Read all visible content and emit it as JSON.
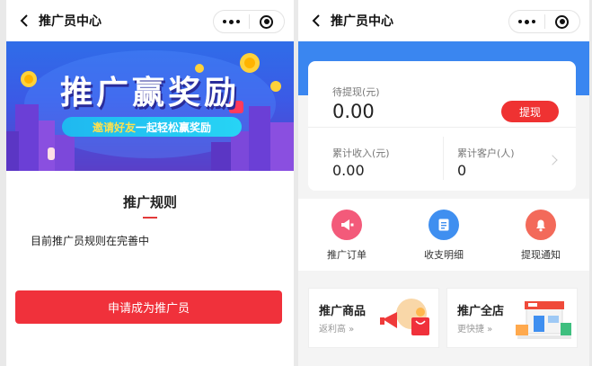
{
  "left": {
    "title": "推广员中心",
    "banner": {
      "headline": "推广赢奖励",
      "subtitle_highlight": "邀请好友",
      "subtitle_rest": "一起轻松赢奖励"
    },
    "rules_title": "推广规则",
    "rules_text": "目前推广员规则在完善中",
    "apply_button": "申请成为推广员"
  },
  "right": {
    "title": "推广员中心",
    "pending_label": "待提现(元)",
    "pending_value": "0.00",
    "withdraw_button": "提现",
    "income_label": "累计收入(元)",
    "income_value": "0.00",
    "customers_label": "累计客户(人)",
    "customers_value": "0",
    "actions": [
      {
        "label": "推广订单",
        "icon": "megaphone-icon",
        "color": "#f35a7a"
      },
      {
        "label": "收支明细",
        "icon": "clipboard-icon",
        "color": "#3f8ff0"
      },
      {
        "label": "提现通知",
        "icon": "bell-icon",
        "color": "#f36a5a"
      }
    ],
    "promo_cards": [
      {
        "title": "推广商品",
        "subtitle": "返利高 »",
        "icon": "megaphone-gift-icon"
      },
      {
        "title": "推广全店",
        "subtitle": "更快捷 »",
        "icon": "store-icon"
      }
    ]
  },
  "colors": {
    "accent_red": "#f0313b",
    "header_blue": "#3a86f0",
    "banner_blue": "#2f6de8"
  }
}
